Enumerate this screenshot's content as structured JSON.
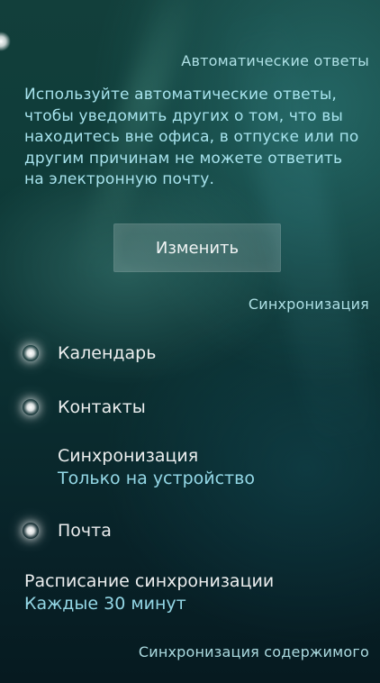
{
  "auto_replies": {
    "header": "Автоматические ответы",
    "description": "Используйте автоматические ответы, чтобы уведомить других о том, что вы находитесь вне офиса, в отпуске или по другим причинам не можете ответить на электронную почту.",
    "edit_button_label": "Изменить"
  },
  "sync_section": {
    "header": "Синхронизация",
    "toggles": [
      {
        "label": "Календарь",
        "state": "on"
      },
      {
        "label": "Контакты",
        "state": "on"
      },
      {
        "label": "Почта",
        "state": "on"
      }
    ],
    "contacts_sync_mode": {
      "title": "Синхронизация",
      "value": "Только на устройство"
    },
    "schedule": {
      "title": "Расписание синхронизации",
      "value": "Каждые 30 минут"
    }
  },
  "content_sync": {
    "header": "Синхронизация содержимого"
  },
  "theme": {
    "accent_text": "#a0e6f5",
    "primary_text": "#ffffff",
    "background_top": "#123f3b",
    "background_bottom": "#061a20"
  }
}
